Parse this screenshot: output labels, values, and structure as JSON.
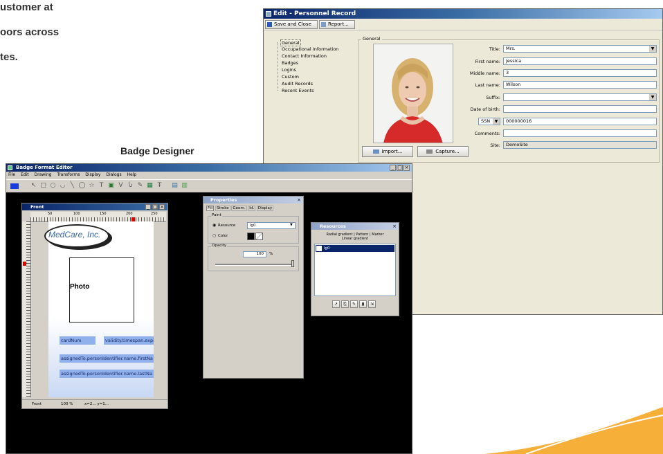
{
  "slide": {
    "text_lines": [
      "ustomer at",
      "oors across",
      "tes."
    ],
    "caption": "Badge Designer"
  },
  "personnel": {
    "title": "Edit - Personnel Record",
    "toolbar": {
      "save_close": "Save and Close",
      "report": "Report..."
    },
    "tree": [
      "General",
      "Occupational Information",
      "Contact Information",
      "Badges",
      "Logins",
      "Custom",
      "Audit Records",
      "Recent Events"
    ],
    "group_label": "General",
    "fields": {
      "title_label": "Title:",
      "title_value": "Mrs.",
      "first_label": "First name:",
      "first_value": "Jessica",
      "middle_label": "Middle name:",
      "middle_value": "3",
      "last_label": "Last name:",
      "last_value": "Wilson",
      "suffix_label": "Suffix:",
      "suffix_value": "",
      "dob_label": "Date of birth:",
      "dob_value": "",
      "id_type": "SSN",
      "id_value": "000000016",
      "comments_label": "Comments:",
      "comments_value": "",
      "site_label": "Site:",
      "site_value": "DemoSite"
    },
    "buttons": {
      "import": "Import...",
      "capture": "Capture..."
    }
  },
  "badge": {
    "title": "Badge Format Editor",
    "menu": [
      "File",
      "Edit",
      "Drawing",
      "Transforms",
      "Display",
      "Dialogs",
      "Help"
    ],
    "front": {
      "title": "Front",
      "ruler": [
        "50",
        "100",
        "150",
        "200",
        "250"
      ],
      "logo": "MedCare, Inc.",
      "photo": "Photo",
      "fields": [
        "cardNum",
        "validity.timespan.expi",
        "assignedTo.personIdentifier.name.firstNa",
        "assignedTo.personIdentifier.name.lastNa"
      ],
      "status": [
        "Front",
        "100 %",
        "x=2... y=1..."
      ]
    },
    "properties": {
      "title": "Properties",
      "tabs": [
        "Fill",
        "Stroke",
        "Geom.",
        "Id.",
        "Display"
      ],
      "paint_label": "Paint",
      "resource_label": "Resource",
      "resource_value": "lg0",
      "color_label": "Color",
      "opacity_label": "Opacity",
      "opacity_value": "100",
      "opacity_unit": "%"
    },
    "resources": {
      "title": "Resources",
      "tabs_line1": "Radial gradient | Pattern | Marker",
      "tabs_line2": "Linear gradient",
      "item": "lg0"
    }
  },
  "colors": {
    "title_blue": "#0a246a",
    "title_blue2": "#3a6ea5",
    "selection": "#0a246a",
    "canvas_black": "#000000",
    "accent_orange": "#f5a623"
  }
}
